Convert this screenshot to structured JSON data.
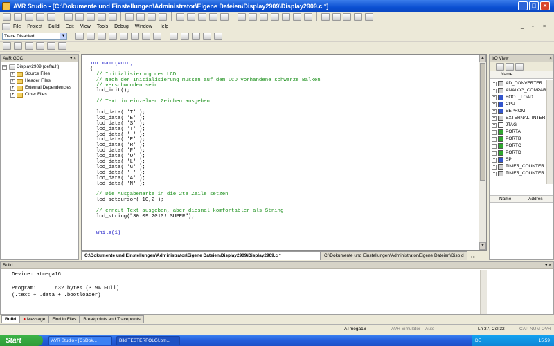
{
  "window": {
    "title": "AVR Studio - [C:\\Dokumente und Einstellungen\\Administrator\\Eigene Dateien\\Display2909\\Display2909.c *]"
  },
  "menu": [
    "File",
    "Project",
    "Build",
    "Edit",
    "View",
    "Tools",
    "Debug",
    "Window",
    "Help"
  ],
  "trace": {
    "value": "Trace Disabled"
  },
  "left_panel": {
    "title": "AVR GCC",
    "root": "Display2909 (default)",
    "items": [
      "Source Files",
      "Header Files",
      "External Dependencies",
      "Other Files"
    ]
  },
  "editor": {
    "lines": [
      {
        "t": "int main(void)",
        "c": "kw"
      },
      {
        "t": "{",
        "c": ""
      },
      {
        "t": "  // Initialisierung des LCD",
        "c": "cm"
      },
      {
        "t": "  // Nach der Initialisierung müssen auf dem LCD vorhandene schwarze Balken",
        "c": "cm"
      },
      {
        "t": "  // verschwunden sein",
        "c": "cm"
      },
      {
        "t": "  lcd_init();",
        "c": ""
      },
      {
        "t": "",
        "c": ""
      },
      {
        "t": "  // Text in einzelnen Zeichen ausgeben",
        "c": "cm"
      },
      {
        "t": "",
        "c": ""
      },
      {
        "t": "  lcd_data( 'T' );",
        "c": ""
      },
      {
        "t": "  lcd_data( 'E' );",
        "c": ""
      },
      {
        "t": "  lcd_data( 'S' );",
        "c": ""
      },
      {
        "t": "  lcd_data( 'T' );",
        "c": ""
      },
      {
        "t": "  lcd_data( ' ' );",
        "c": ""
      },
      {
        "t": "  lcd_data( 'E' );",
        "c": ""
      },
      {
        "t": "  lcd_data( 'R' );",
        "c": ""
      },
      {
        "t": "  lcd_data( 'F' );",
        "c": ""
      },
      {
        "t": "  lcd_data( 'O' );",
        "c": ""
      },
      {
        "t": "  lcd_data( 'L' );",
        "c": ""
      },
      {
        "t": "  lcd_data( 'G' );",
        "c": ""
      },
      {
        "t": "  lcd_data( ' ' );",
        "c": ""
      },
      {
        "t": "  lcd_data( 'A' );",
        "c": ""
      },
      {
        "t": "  lcd_data( 'N' );",
        "c": ""
      },
      {
        "t": "",
        "c": ""
      },
      {
        "t": "  // Die Ausgabemarke in die 2te Zeile setzen",
        "c": "cm"
      },
      {
        "t": "  lcd_setcursor( 10,2 );",
        "c": ""
      },
      {
        "t": "",
        "c": ""
      },
      {
        "t": "  // erneut Text ausgeben, aber diesmal komfortabler als String",
        "c": "cm"
      },
      {
        "t": "  lcd_string(\"30.09.2010! SUPER\");",
        "c": ""
      },
      {
        "t": "",
        "c": ""
      },
      {
        "t": "",
        "c": ""
      },
      {
        "t": "  while(1)",
        "c": "kw"
      }
    ],
    "tabs": [
      "C:\\Dokumente und Einstellungen\\Administrator\\Eigene Dateien\\Display2909\\Display2909.c *",
      "C:\\Dokumente und Einstellungen\\Administrator\\Eigene Dateien\\Disp d"
    ]
  },
  "io_view": {
    "title": "I/O View",
    "col": "Name",
    "items": [
      "AD_CONVERTER",
      "ANALOG_COMPAR",
      "BOOT_LOAD",
      "CPU",
      "EEPROM",
      "EXTERNAL_INTER",
      "JTAG",
      "PORTA",
      "PORTB",
      "PORTC",
      "PORTD",
      "SPI",
      "TIMER_COUNTER",
      "TIMER_COUNTER"
    ],
    "lower_cols": [
      "Name",
      "Addres"
    ]
  },
  "build": {
    "title": "Build",
    "lines": [
      "Device: atmega16",
      "",
      "Program:      632 bytes (3.9% Full)",
      "(.text + .data + .bootloader)"
    ],
    "tabs": [
      "Build",
      "Message",
      "Find in Files",
      "Breakpoints and Tracepoints"
    ]
  },
  "status": {
    "device": "ATmega16",
    "tool": "AVR Simulator",
    "mode": "Auto",
    "pos": "Ln 37, Col 32",
    "flags": "CAP  NUM  OVR"
  },
  "taskbar": {
    "start": "Start",
    "tasks": [
      "AVR Studio - [C:\\Dok...",
      "Bild TESTERFOLG!.bm..."
    ],
    "lang": "DE",
    "clock": "15:59"
  }
}
